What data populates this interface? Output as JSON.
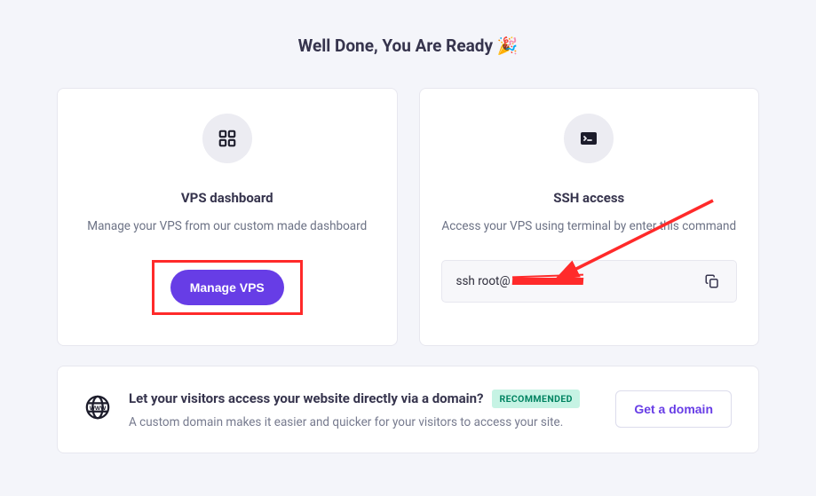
{
  "heading": "Well Done, You Are Ready 🎉",
  "vps_card": {
    "title": "VPS dashboard",
    "desc": "Manage your VPS from our custom made dashboard",
    "button": "Manage VPS"
  },
  "ssh_card": {
    "title": "SSH access",
    "desc": "Access your VPS using terminal by enter this command",
    "command_prefix": "ssh root@"
  },
  "domain_card": {
    "heading": "Let your visitors access your website directly via a domain?",
    "badge": "RECOMMENDED",
    "sub": "A custom domain makes it easier and quicker for your visitors to access your site.",
    "button": "Get a domain"
  }
}
